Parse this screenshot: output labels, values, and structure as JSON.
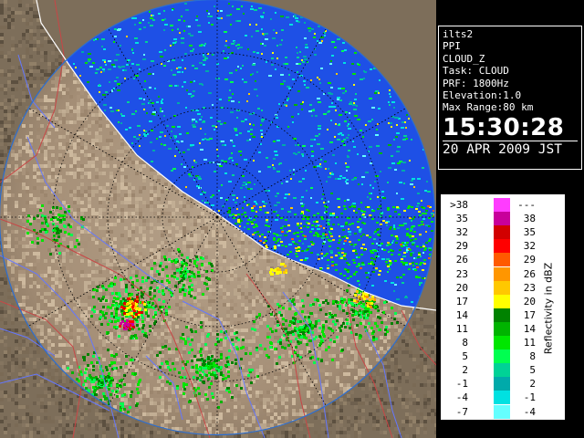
{
  "info": {
    "station": "ilts2",
    "scan_type": "PPI",
    "product": "CLOUD_Z",
    "task": "Task: CLOUD",
    "prf": "PRF: 1800Hz",
    "elevation": "Elevation:1.0",
    "max_range": "Max Range:80 km",
    "time": "15:30:28",
    "date": "20 APR 2009 JST"
  },
  "legend": {
    "title": "Reflectivity in dBZ",
    "rows": [
      {
        "low": ">38",
        "high": "---",
        "color": "#ff3cff"
      },
      {
        "low": "35",
        "high": "38",
        "color": "#c8009b"
      },
      {
        "low": "32",
        "high": "35",
        "color": "#d20000"
      },
      {
        "low": "29",
        "high": "32",
        "color": "#ff0000"
      },
      {
        "low": "26",
        "high": "29",
        "color": "#ff5a00"
      },
      {
        "low": "23",
        "high": "26",
        "color": "#ff9600"
      },
      {
        "low": "20",
        "high": "23",
        "color": "#ffc800"
      },
      {
        "low": "17",
        "high": "20",
        "color": "#ffff00"
      },
      {
        "low": "14",
        "high": "17",
        "color": "#008200"
      },
      {
        "low": "11",
        "high": "14",
        "color": "#00b400"
      },
      {
        "low": "8",
        "high": "11",
        "color": "#00e600"
      },
      {
        "low": "5",
        "high": "8",
        "color": "#00ff50"
      },
      {
        "low": "2",
        "high": "5",
        "color": "#00d296"
      },
      {
        "low": "-1",
        "high": "2",
        "color": "#00aaaa"
      },
      {
        "low": "-4",
        "high": "-1",
        "color": "#00e1e1"
      },
      {
        "low": "-7",
        "high": "-4",
        "color": "#64ffff"
      }
    ]
  },
  "map_colors": {
    "sea": "#1e50e6",
    "coverage_edge": "#2a6ed2",
    "land_far": "#7d6e5a",
    "land_near": "#ae9a82",
    "river": "#6478ff",
    "boundary": "#c84646",
    "range_ring": "#000000",
    "coast": "#ffffff"
  }
}
